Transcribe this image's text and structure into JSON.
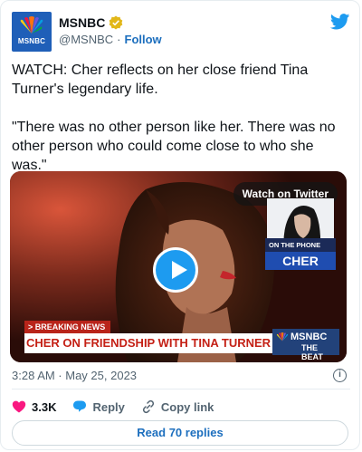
{
  "account": {
    "name": "MSNBC",
    "handle": "@MSNBC",
    "separator": "·",
    "follow": "Follow",
    "avatar_text": "MSNBC"
  },
  "tweet": {
    "paragraphs": [
      "WATCH: Cher reflects on her close friend Tina Turner's legendary life.",
      "\"There was no other person like her. There was no other person who could come close to who she was.\""
    ],
    "timestamp": "3:28 AM · May 25, 2023"
  },
  "media": {
    "watch_label": "Watch on Twitter",
    "on_the_phone": "ON THE PHONE",
    "guest_name": "CHER",
    "breaking": "> BREAKING NEWS",
    "headline": "CHER ON FRIENDSHIP WITH TINA TURNER",
    "brand": "MSNBC",
    "show": "THE BEAT"
  },
  "actions": {
    "likes": "3.3K",
    "reply": "Reply",
    "copy": "Copy link",
    "read_replies": "Read 70 replies"
  },
  "colors": {
    "accent": "#1d9bf0",
    "like": "#f91880",
    "link": "#1d6fbe"
  },
  "icons": [
    "peacock-logo-icon",
    "verified-badge-icon",
    "twitter-bird-icon",
    "play-icon",
    "info-icon",
    "heart-icon",
    "reply-icon",
    "link-icon"
  ]
}
